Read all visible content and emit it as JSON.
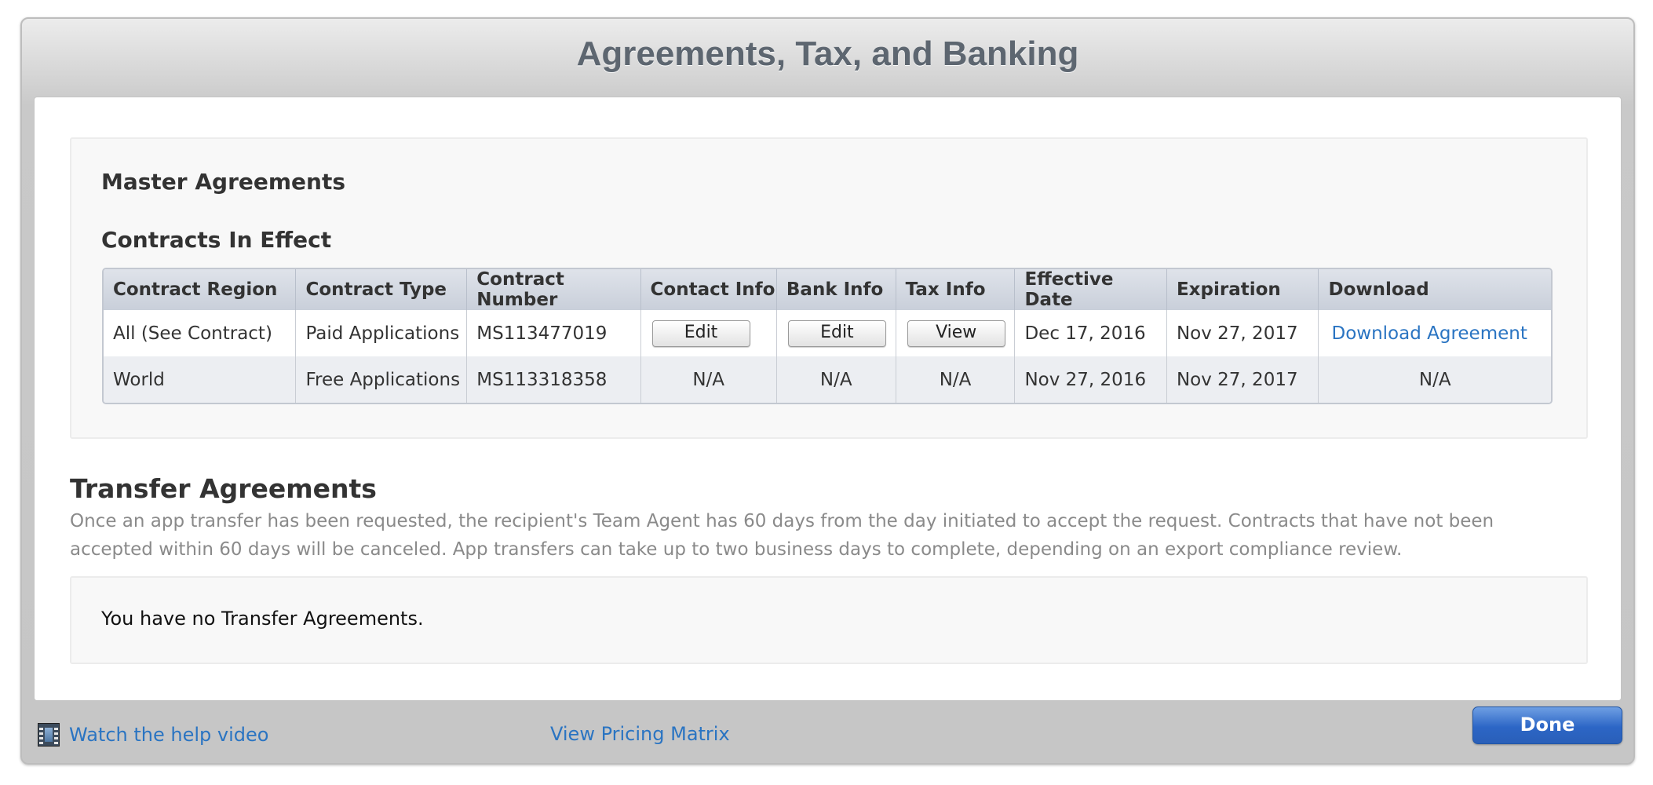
{
  "window": {
    "title": "Agreements, Tax, and Banking"
  },
  "master": {
    "heading": "Master Agreements",
    "subheading": "Contracts In Effect",
    "columns": [
      "Contract Region",
      "Contract Type",
      "Contract Number",
      "Contact Info",
      "Bank Info",
      "Tax Info",
      "Effective Date",
      "Expiration",
      "Download"
    ],
    "rows": [
      {
        "region": "All (See Contract)",
        "type": "Paid Applications",
        "number": "MS113477019",
        "contact": "Edit",
        "bank": "Edit",
        "tax": "View",
        "effective": "Dec 17, 2016",
        "expiration": "Nov 27, 2017",
        "download": "Download Agreement"
      },
      {
        "region": "World",
        "type": "Free Applications",
        "number": "MS113318358",
        "contact": "N/A",
        "bank": "N/A",
        "tax": "N/A",
        "effective": "Nov 27, 2016",
        "expiration": "Nov 27, 2017",
        "download": "N/A"
      }
    ]
  },
  "transfer": {
    "heading": "Transfer Agreements",
    "description": "Once an app transfer has been requested, the recipient's Team Agent has 60 days from the day initiated to accept the request. Contracts that have not been accepted within 60 days will be canceled. App transfers can take up to two business days to complete, depending on an export compliance review.",
    "empty_message": "You have no Transfer Agreements."
  },
  "footer": {
    "help_icon": "film-icon",
    "help_link": "Watch the help video",
    "pricing_link": "View Pricing Matrix",
    "done_label": "Done"
  },
  "colors": {
    "link": "#2a74c2",
    "done_button": "#2c66c6",
    "title": "#5d6670"
  }
}
